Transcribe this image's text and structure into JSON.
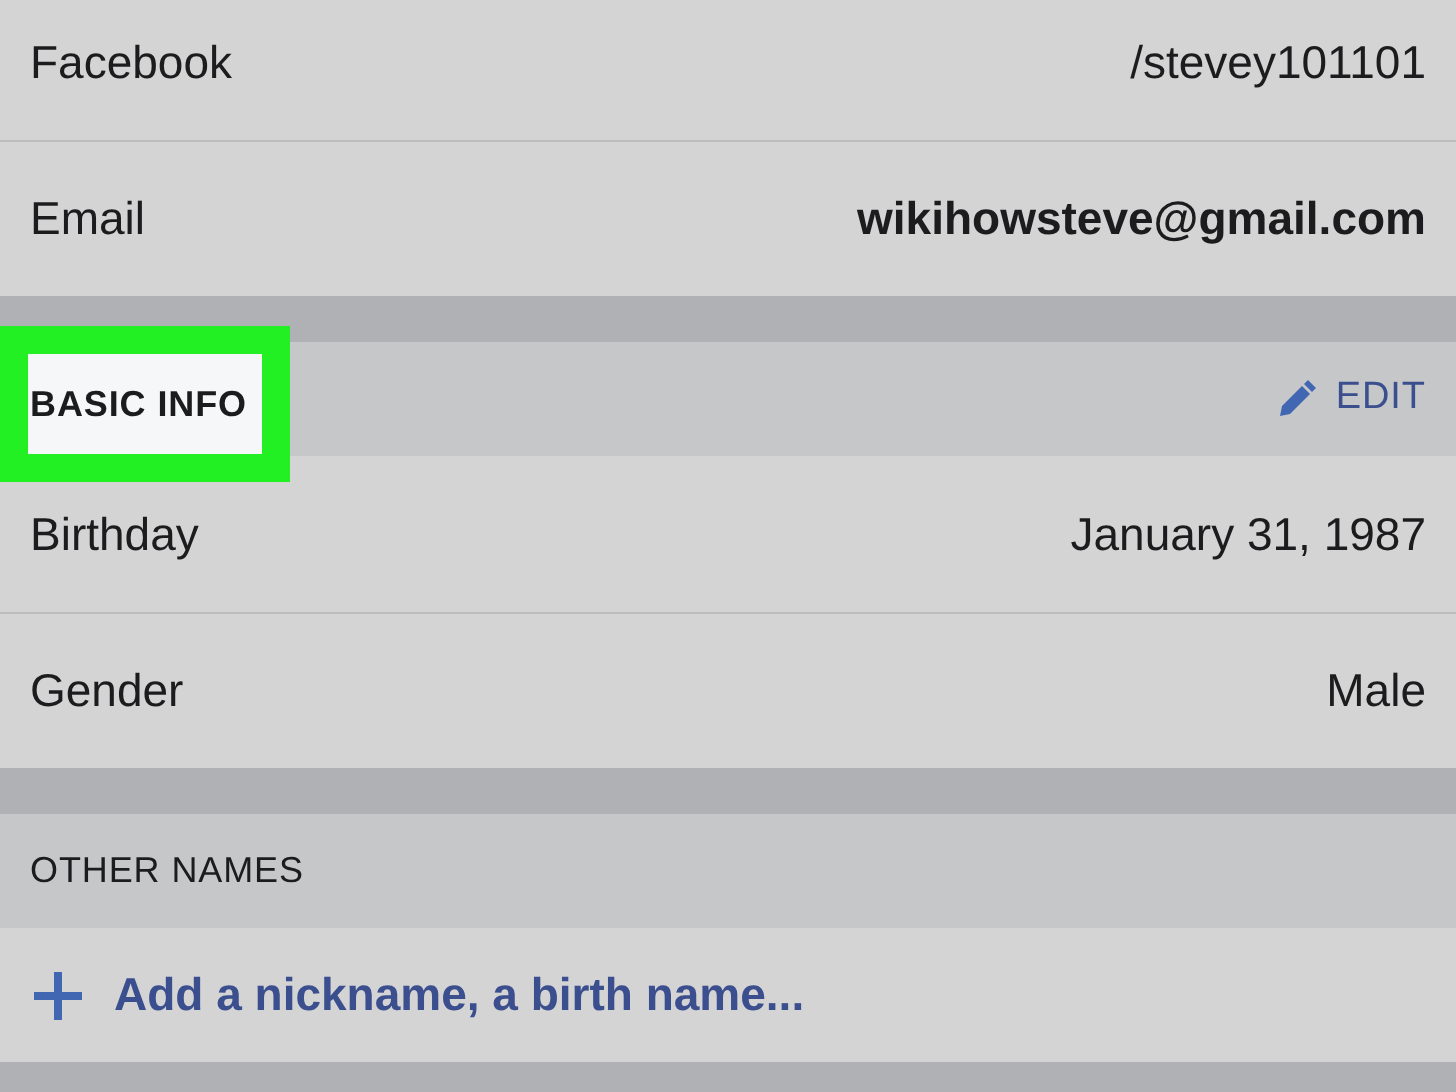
{
  "contact_rows": [
    {
      "label": "Facebook",
      "value": "/stevey101101",
      "bold": false
    },
    {
      "label": "Email",
      "value": "wikihowsteve@gmail.com",
      "bold": true
    }
  ],
  "sections": [
    {
      "title": "BASIC INFO",
      "highlighted": true,
      "action": {
        "label": "EDIT"
      },
      "rows": [
        {
          "label": "Birthday",
          "value": "January 31, 1987"
        },
        {
          "label": "Gender",
          "value": "Male"
        }
      ]
    },
    {
      "title": "OTHER NAMES",
      "highlighted": false,
      "add_item": {
        "label": "Add a nickname, a birth name..."
      }
    }
  ]
}
